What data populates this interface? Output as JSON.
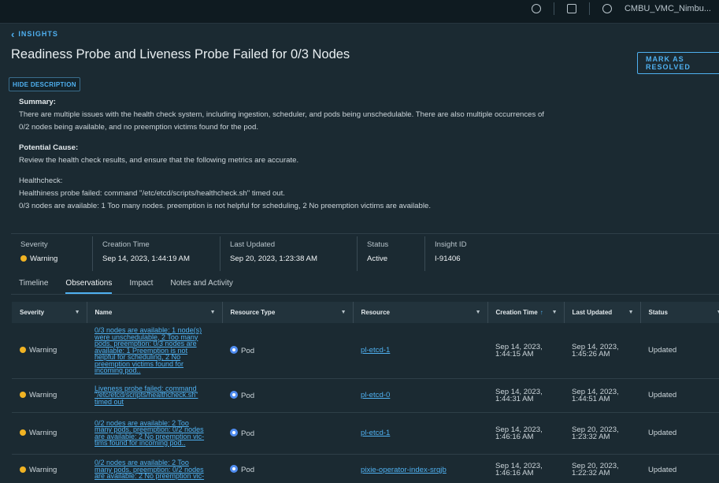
{
  "header": {
    "user": "CMBU_VMC_Nimbu..."
  },
  "nav": {
    "back_label": "INSIGHTS"
  },
  "page": {
    "title": "Readiness Probe and Liveness Probe Failed for 0/3 Nodes",
    "resolve_label": "MARK AS RESOLVED",
    "hide_description_label": "HIDE DESCRIPTION"
  },
  "description": {
    "summary_heading": "Summary:",
    "summary_line1": "There are multiple issues with the health check system, including ingestion, scheduler, and pods being unschedulable. There are also multiple occurrences of",
    "summary_line2": "0/2 nodes being available, and no preemption victims found for the pod.",
    "cause_heading": "Potential Cause:",
    "cause_text": "Review the health check results, and ensure that the following metrics are accurate.",
    "healthcheck_heading": "Healthcheck:",
    "healthcheck_line1": "Healthiness probe failed: command \"/etc/etcd/scripts/healthcheck.sh\" timed out.",
    "healthcheck_line2": "0/3 nodes are available: 1 Too many nodes. preemption is not helpful for scheduling, 2 No preemption victims are available."
  },
  "meta": {
    "severity_label": "Severity",
    "severity_value": "Warning",
    "creation_label": "Creation Time",
    "creation_value": "Sep 14, 2023, 1:44:19 AM",
    "updated_label": "Last Updated",
    "updated_value": "Sep 20, 2023, 1:23:38 AM",
    "status_label": "Status",
    "status_value": "Active",
    "id_label": "Insight ID",
    "id_value": "I-91406"
  },
  "colors": {
    "warning": "#f0b323",
    "accent": "#4fb0f0",
    "pod": "#4f8cf0"
  },
  "tabs": [
    {
      "label": "Timeline"
    },
    {
      "label": "Observations"
    },
    {
      "label": "Impact"
    },
    {
      "label": "Notes and Activity"
    }
  ],
  "table": {
    "headers": {
      "severity": "Severity",
      "name": "Name",
      "resource_type": "Resource Type",
      "resource": "Resource",
      "creation": "Creation Time",
      "updated": "Last Updated",
      "status": "Status"
    },
    "rows": [
      {
        "severity": "Warning",
        "name": "0/3 nodes are available: 1 node(s) were unschedulable, 2 Too many pods. preemption: 0/3 nodes are available: 1 Preemption is not helpful for scheduling, 2 No preemption victims found for incoming pod..",
        "resource_type": "Pod",
        "resource": "pl-etcd-1",
        "creation": "Sep 14, 2023, 1:44:15 AM",
        "updated": "Sep 14, 2023, 1:45:26 AM",
        "status": "Updated"
      },
      {
        "severity": "Warning",
        "name": "Liveness probe failed: command \"/etc/etcd/scripts/healthcheck.sh\" timed out",
        "resource_type": "Pod",
        "resource": "pl-etcd-0",
        "creation": "Sep 14, 2023, 1:44:31 AM",
        "updated": "Sep 14, 2023, 1:44:51 AM",
        "status": "Updated"
      },
      {
        "severity": "Warning",
        "name": "0/2 nodes are available: 2 Too many pods. preemption: 0/2 nodes are available: 2 No preemption vic- tims found for incoming pod..",
        "resource_type": "Pod",
        "resource": "pl-etcd-1",
        "creation": "Sep 14, 2023, 1:46:16 AM",
        "updated": "Sep 20, 2023, 1:23:32 AM",
        "status": "Updated"
      },
      {
        "severity": "Warning",
        "name": "0/2 nodes are available: 2 Too many pods. preemption: 0/2 nodes are available: 2 No preemption vic-",
        "resource_type": "Pod",
        "resource": "pixie-operator-index-srqjb",
        "creation": "Sep 14, 2023, 1:46:16 AM",
        "updated": "Sep 20, 2023, 1:22:32 AM",
        "status": "Updated"
      }
    ]
  }
}
